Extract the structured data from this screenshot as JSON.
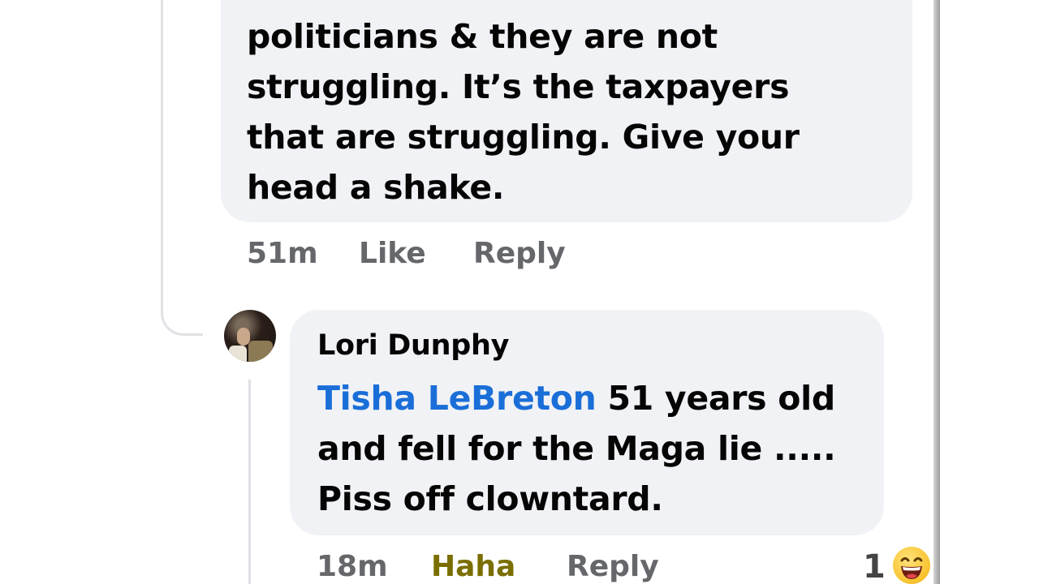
{
  "first_comment": {
    "lines": [
      "politicians & they are not",
      "struggling. It’s the taxpayers",
      "that are struggling. Give your",
      "head a shake."
    ],
    "time": "51m",
    "like_label": "Like",
    "reply_label": "Reply"
  },
  "reply_comment": {
    "author": "Lori Dunphy",
    "mention": "Tisha LeBreton",
    "line1_rest": " 51 years old",
    "line2": "and fell for the Maga lie .....",
    "line3": "Piss off clowntard.",
    "time": "18m",
    "reaction_label": "Haha",
    "reply_label": "Reply",
    "reaction_count": "1",
    "reaction_icon": "laughing-emoji-icon",
    "colors": {
      "mention": "#1a6ed8",
      "haha": "#7a6e00",
      "meta": "#65676b",
      "bubble": "#f0f2f5"
    }
  }
}
